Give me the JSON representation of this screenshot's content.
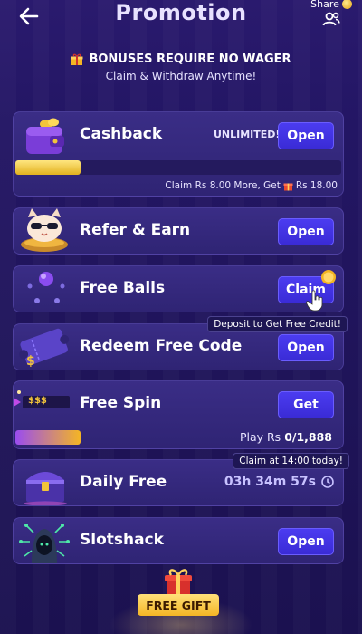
{
  "header": {
    "title": "Promotion",
    "share_label": "Share"
  },
  "notice": {
    "line1": "BONUSES REQUIRE NO WAGER",
    "line2": "Claim & Withdraw Anytime!"
  },
  "cards": {
    "cashback": {
      "label": "Cashback",
      "badge": "UNLIMITED!",
      "button": "Open",
      "progress_fraction": 0.2,
      "footer_prefix": "Claim Rs 8.00 More, Get",
      "footer_suffix": "Rs 18.00"
    },
    "refer": {
      "label": "Refer & Earn",
      "button": "Open"
    },
    "free_balls": {
      "label": "Free Balls",
      "button": "Claim"
    },
    "redeem": {
      "label": "Redeem Free Code",
      "button": "Open",
      "tip": "Deposit to Get Free Credit!"
    },
    "free_spin": {
      "label": "Free Spin",
      "button": "Get",
      "icon_text": "$$$",
      "progress_fraction": 0.2,
      "footer_prefix": "Play Rs",
      "footer_value": "0/1,888"
    },
    "daily": {
      "label": "Daily Free",
      "timer": "03h 34m 57s",
      "tip": "Claim at 14:00 today!"
    },
    "slotshack": {
      "label": "Slotshack",
      "button": "Open"
    }
  },
  "footer": {
    "gift_label": "FREE GIFT"
  },
  "colors": {
    "accent_button": "#4b3cf0",
    "card_bg": "#3a2d86",
    "gold": "#f4b524",
    "page_bg": "#231664"
  }
}
